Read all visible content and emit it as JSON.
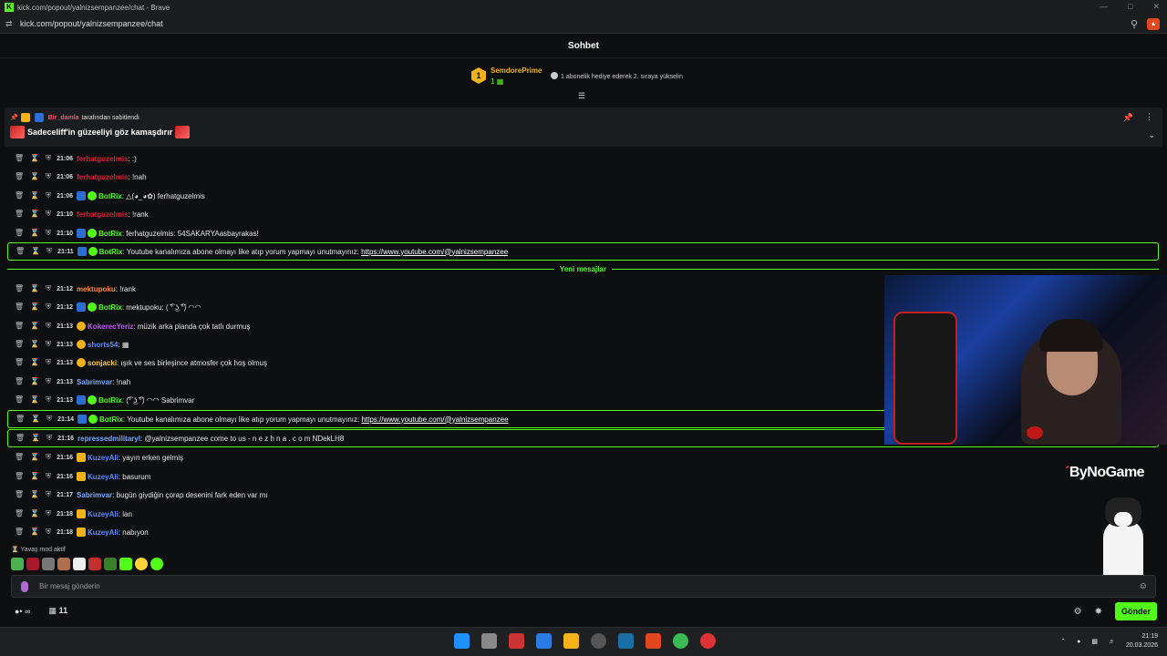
{
  "window": {
    "title": "kick.com/popout/yalnizsempanzee/chat - Brave",
    "url": "kick.com/popout/yalnizsempanzee/chat"
  },
  "header": {
    "title": "Sohbet"
  },
  "subscriber_leader": {
    "rank": "1",
    "name": "SemdorePrime",
    "count": "1",
    "hint": "1 abonelik hediye ederek 2. sıraya yükselin"
  },
  "pinned": {
    "by_user": "Bir_damla",
    "by_suffix": "tarafından sabitlendi",
    "message": "Sadeceliff'in güzeeliyi göz kamaşdırır"
  },
  "messages": [
    {
      "time": "21:06",
      "user": "ferhatguzelmis",
      "color": "#e01e3c",
      "text": ":)",
      "badges": []
    },
    {
      "time": "21:06",
      "user": "ferhatguzelmis",
      "color": "#e01e3c",
      "text": "!nah",
      "badges": []
    },
    {
      "time": "21:06",
      "user": "BotRix",
      "color": "#53fc18",
      "text": "△(◕_◕✿) ferhatguzelmis",
      "badges": [
        "bot",
        "ver"
      ]
    },
    {
      "time": "21:10",
      "user": "ferhatguzelmis",
      "color": "#e01e3c",
      "text": "!rank",
      "badges": []
    },
    {
      "time": "21:10",
      "user": "BotRix",
      "color": "#53fc18",
      "text": "ferhatguzelmis: 54SAKARYAasbayrakas!",
      "badges": [
        "bot",
        "ver"
      ]
    },
    {
      "time": "21:11",
      "user": "BotRix",
      "color": "#53fc18",
      "text": "Youtube kanalımıza abone olmayı like atıp yorum yapmayı unutmayınız:",
      "link": "https://www.youtube.com/@yalnizsempanzee",
      "badges": [
        "bot",
        "ver"
      ],
      "highlight": true
    },
    {
      "time": "21:12",
      "user": "mektupoku",
      "color": "#ff8a3d",
      "text": "!rank",
      "badges": []
    },
    {
      "time": "21:12",
      "user": "BotRix",
      "color": "#53fc18",
      "text": "mektupoku: ( ͡° ͜ʖ ͡°) ◠◠",
      "badges": [
        "bot",
        "ver"
      ]
    },
    {
      "time": "21:13",
      "user": "KokerecYeriz",
      "color": "#c159f5",
      "text": "müzik arka planda çok tatlı durmuş",
      "badges": [
        "sub"
      ]
    },
    {
      "time": "21:13",
      "user": "shorts54",
      "color": "#5b8cff",
      "text": "▦",
      "badges": [
        "sub"
      ]
    },
    {
      "time": "21:13",
      "user": "sonjacki",
      "color": "#ffd23a",
      "text": "ışık ve ses birleşince atmosfer çok hoş olmuş",
      "badges": [
        "sub"
      ]
    },
    {
      "time": "21:13",
      "user": "Sabrimvar",
      "color": "#7aa8ff",
      "text": "!nah",
      "badges": []
    },
    {
      "time": "21:13",
      "user": "BotRix",
      "color": "#53fc18",
      "text": "(͡° ͜ʖ ͡°) ◠◠ Sabrimvar",
      "badges": [
        "bot",
        "ver"
      ]
    },
    {
      "time": "21:14",
      "user": "BotRix",
      "color": "#53fc18",
      "text": "Youtube kanalımıza abone olmayı like atıp yorum yapmayı unutmayınız:",
      "link": "https://www.youtube.com/@yalnizsempanzee",
      "badges": [
        "bot",
        "ver"
      ],
      "highlight": true
    },
    {
      "time": "21:16",
      "user": "repressedmilitaryl",
      "color": "#7aa8ff",
      "text": "@yalnizsempanzee come to us - n e z h n a . c o m NDekLH8",
      "badges": [],
      "highlight": true
    },
    {
      "time": "21:16",
      "user": "KuzeyAli",
      "color": "#5b8cff",
      "text": "yayın erken gelmiş",
      "badges": [
        "crown"
      ]
    },
    {
      "time": "21:16",
      "user": "KuzeyAli",
      "color": "#5b8cff",
      "text": "basurum",
      "badges": [
        "crown"
      ]
    },
    {
      "time": "21:17",
      "user": "Sabrimvar",
      "color": "#7aa8ff",
      "text": "bugün giydiğin çorap desenini fark eden var mı",
      "badges": []
    },
    {
      "time": "21:18",
      "user": "KuzeyAli",
      "color": "#5b8cff",
      "text": "lan",
      "badges": [
        "crown"
      ]
    },
    {
      "time": "21:18",
      "user": "KuzeyAli",
      "color": "#5b8cff",
      "text": "nabıyon",
      "badges": [
        "crown"
      ]
    }
  ],
  "new_messages_label": "Yeni mesajlar",
  "overlay": {
    "brand_prefix": "´",
    "brand": "ByNoGame"
  },
  "slow_mode": "Yavaş mod aktif",
  "input": {
    "placeholder": "Bir mesaj gönderin"
  },
  "bottom": {
    "points": "∞",
    "gifts": "11",
    "send_label": "Gönder"
  },
  "taskbar": {
    "time": "21:19",
    "date": "20.03.2026"
  }
}
